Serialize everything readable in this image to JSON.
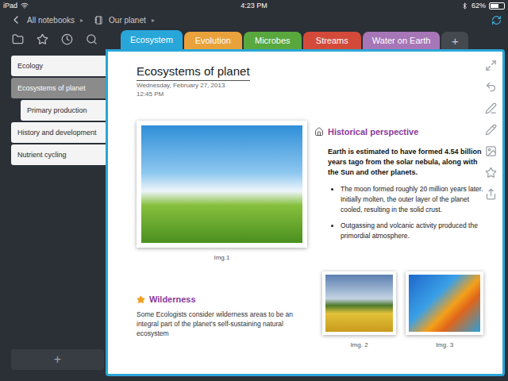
{
  "status_bar": {
    "device": "iPad",
    "time": "4:23 PM",
    "battery": {
      "reading": "62%",
      "level": 0.62
    }
  },
  "breadcrumb": [
    {
      "label": "All notebooks",
      "separator": "▸"
    },
    {
      "label": "Our planet",
      "separator": "▸"
    }
  ],
  "tabs": [
    {
      "label": "Ecosystem",
      "selected": true,
      "color": "#29a6d9"
    },
    {
      "label": "Evolution",
      "selected": false,
      "color": "#e9a23b"
    },
    {
      "label": "Microbes",
      "selected": false,
      "color": "#58a83d"
    },
    {
      "label": "Streams",
      "selected": false,
      "color": "#d44a3a"
    },
    {
      "label": "Water on Earth",
      "selected": false,
      "color": "#a676b6"
    }
  ],
  "add_tab": "+",
  "sidebar": {
    "items": [
      {
        "label": "Ecology",
        "selected": false,
        "kind": "page"
      },
      {
        "label": "Ecosystems of planet",
        "selected": true,
        "kind": "page"
      },
      {
        "label": "Primary production",
        "selected": false,
        "kind": "subpage"
      },
      {
        "label": "History and development",
        "selected": false,
        "kind": "page"
      },
      {
        "label": "Nutrient cycling",
        "selected": false,
        "kind": "page"
      }
    ],
    "add": "+"
  },
  "note": {
    "title": "Ecosystems of planet",
    "date": "Wednesday, February 27, 2013",
    "time": "12:45 PM",
    "main_image": {
      "caption": "Img.1"
    },
    "history": {
      "heading": "Historical perspective",
      "lead": "Earth is estimated to have formed 4.54 billion years tago from the solar nebula, along with the Sun and other planets.",
      "bullets": [
        "The moon formed roughly 20 million years later. Initially molten, the outer layer of the planet cooled, resulting in the solid crust.",
        "Outgassing and volcanic activity produced the primordial atmosphere."
      ]
    },
    "wilderness": {
      "heading": "Wilderness",
      "text": "Some Ecologists consider wilderness areas to be an integral part of the planet's self-sustaining natural ecosystem"
    },
    "gallery": [
      {
        "caption": "Img. 2"
      },
      {
        "caption": "Img. 3"
      }
    ]
  }
}
